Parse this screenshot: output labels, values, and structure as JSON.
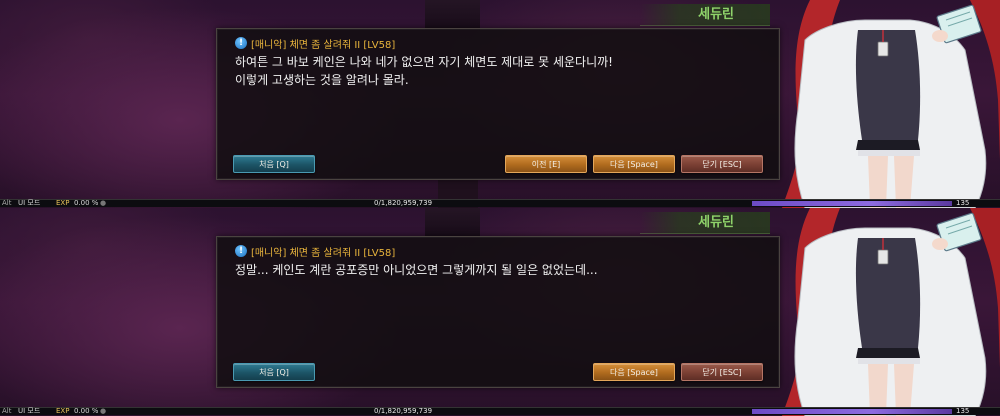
{
  "panels": [
    {
      "npc_name": "세듀린",
      "quest_title": "[매니악] 체면 좀 살려줘 II [LV58]",
      "dialogue": "하여튼 그 바보 케인은 나와 네가 없으면 자기 체면도 제대로 못 세운다니까!\n이렇게 고생하는 것을 알려나 몰라.",
      "buttons": {
        "first": "처음 [Q]",
        "prev": "이전 [E]",
        "next": "다음 [Space]",
        "close": "닫기 [ESC]"
      },
      "status": {
        "alt": "Alt",
        "ui_mode": "UI 모드",
        "exp_label": "EXP",
        "exp_percent": "0.00 %",
        "exp_numbers": "0/1,820,959,739",
        "level": "135"
      }
    },
    {
      "npc_name": "세듀린",
      "quest_title": "[매니악] 체면 좀 살려줘 II [LV58]",
      "dialogue": "정말... 케인도 계란 공포증만 아니었으면 그렇게까지 될 일은 없었는데...",
      "buttons": {
        "first": "처음 [Q]",
        "next": "다음 [Space]",
        "close": "닫기 [ESC]"
      },
      "status": {
        "alt": "Alt",
        "ui_mode": "UI 모드",
        "exp_label": "EXP",
        "exp_percent": "0.00 %",
        "exp_numbers": "0/1,820,959,739",
        "level": "135"
      }
    }
  ],
  "icons": {
    "quest": "quest-info-icon"
  },
  "colors": {
    "quest_title": "#e8b43c",
    "npc_name": "#8fd36a",
    "button_first": "#1c5466",
    "button_orange": "#b06b1e",
    "button_close": "#7a3f33",
    "level_bar": "#8d6be0"
  }
}
